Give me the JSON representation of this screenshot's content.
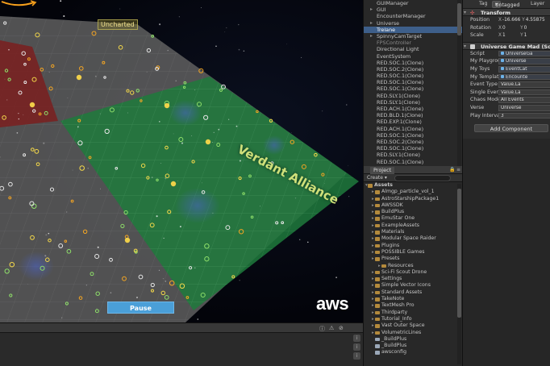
{
  "scene": {
    "region_uncharted": "Uncharted",
    "region_verdant": "Verdant Alliance",
    "pause_label": "Pause",
    "logo_text": "aws"
  },
  "colors": {
    "grid_gray": "#6a6a6a",
    "territory_red": "#7a1f1f",
    "territory_green": "#1f7a3c",
    "pause_button": "#4a9fd8",
    "selection": "#3e5f8a"
  },
  "hierarchy": {
    "items": [
      {
        "label": "GUIManager",
        "type": "plain"
      },
      {
        "label": "GUI",
        "type": "parent"
      },
      {
        "label": "EncounterManager",
        "type": "plain"
      },
      {
        "label": "Universe",
        "type": "parent"
      },
      {
        "label": "Trelane",
        "type": "selected"
      },
      {
        "label": "SpinnyCamTarget",
        "type": "parent"
      },
      {
        "label": "FPSController",
        "type": "dim"
      },
      {
        "label": "Directional Light",
        "type": "plain"
      },
      {
        "label": "EventSystem",
        "type": "plain"
      },
      {
        "label": "RED.SOC.1(Clone)",
        "type": "plain"
      },
      {
        "label": "RED.SOC.2(Clone)",
        "type": "plain"
      },
      {
        "label": "RED.SOC.1(Clone)",
        "type": "plain"
      },
      {
        "label": "RED.SOC.1(Clone)",
        "type": "plain"
      },
      {
        "label": "RED.SOC.1(Clone)",
        "type": "plain"
      },
      {
        "label": "RED.SLY.1(Clone)",
        "type": "plain"
      },
      {
        "label": "RED.SLY.1(Clone)",
        "type": "plain"
      },
      {
        "label": "RED.ACH.1(Clone)",
        "type": "plain"
      },
      {
        "label": "RED.BLD.1(Clone)",
        "type": "plain"
      },
      {
        "label": "RED.EXP.1(Clone)",
        "type": "plain"
      },
      {
        "label": "RED.ACH.1(Clone)",
        "type": "plain"
      },
      {
        "label": "RED.SOC.1(Clone)",
        "type": "plain"
      },
      {
        "label": "RED.SOC.2(Clone)",
        "type": "plain"
      },
      {
        "label": "RED.SOC.1(Clone)",
        "type": "plain"
      },
      {
        "label": "RED.SLY.1(Clone)",
        "type": "plain"
      },
      {
        "label": "RED.SOC.1(Clone)",
        "type": "plain"
      }
    ]
  },
  "project": {
    "tab_label": "Project",
    "create_label": "Create",
    "items": [
      {
        "label": "Assets",
        "type": "root"
      },
      {
        "label": "Almgp_particle_vol_1",
        "type": "folder"
      },
      {
        "label": "AstroStarshipPackage1",
        "type": "folder"
      },
      {
        "label": "AWSSDK",
        "type": "folder"
      },
      {
        "label": "BuildPlus",
        "type": "folder"
      },
      {
        "label": "EmuStar One",
        "type": "folder"
      },
      {
        "label": "ExampleAssets",
        "type": "folder"
      },
      {
        "label": "Materials",
        "type": "folder"
      },
      {
        "label": "Modular Space Raider",
        "type": "folder"
      },
      {
        "label": "Plugins",
        "type": "folder"
      },
      {
        "label": "POSSIBLE Games",
        "type": "folder"
      },
      {
        "label": "Presets",
        "type": "folder"
      },
      {
        "label": "Resources",
        "type": "child"
      },
      {
        "label": "Sci-Fi Scout Drone",
        "type": "folder"
      },
      {
        "label": "Settings",
        "type": "folder"
      },
      {
        "label": "Simple Vector Icons",
        "type": "folder"
      },
      {
        "label": "Standard Assets",
        "type": "folder"
      },
      {
        "label": "TakeNote",
        "type": "folder"
      },
      {
        "label": "TextMesh Pro",
        "type": "folder"
      },
      {
        "label": "Thirdparty",
        "type": "folder"
      },
      {
        "label": "Tutorial_Info",
        "type": "folder"
      },
      {
        "label": "Vast Outer Space",
        "type": "folder"
      },
      {
        "label": "VolumetricLines",
        "type": "folder"
      },
      {
        "label": "_BuildPlus",
        "type": "file"
      },
      {
        "label": "_BuildPlus",
        "type": "file"
      },
      {
        "label": "awsconfig",
        "type": "file"
      }
    ]
  },
  "inspector": {
    "tag_label": "Tag",
    "tag_value": "Untagged",
    "layer_label": "Layer",
    "transform": {
      "title": "Transform",
      "position_label": "Position",
      "position": {
        "x": "-16.666",
        "y": "4.55875"
      },
      "rotation_label": "Rotation",
      "rotation": {
        "x": "0",
        "y": "0"
      },
      "scale_label": "Scale",
      "scale": {
        "x": "1",
        "y": "1"
      }
    },
    "script": {
      "title": "Universe Game Mad (Sc",
      "props": [
        {
          "label": "Script",
          "value": "UniverseGa"
        },
        {
          "label": "My Playground",
          "value": "Universe"
        },
        {
          "label": "My Toys",
          "value": "EventCat"
        },
        {
          "label": "My Template",
          "value": "Encounte"
        },
        {
          "label": "Event Type GUI",
          "value": "Value.La"
        },
        {
          "label": "Single Event Happy",
          "value": "Value.La"
        },
        {
          "label": "Chaos Mode",
          "value": "All Events"
        },
        {
          "label": "Verse",
          "value": "Universe"
        },
        {
          "label": "Play Interval",
          "value": "3"
        }
      ]
    },
    "add_component_label": "Add Component"
  }
}
